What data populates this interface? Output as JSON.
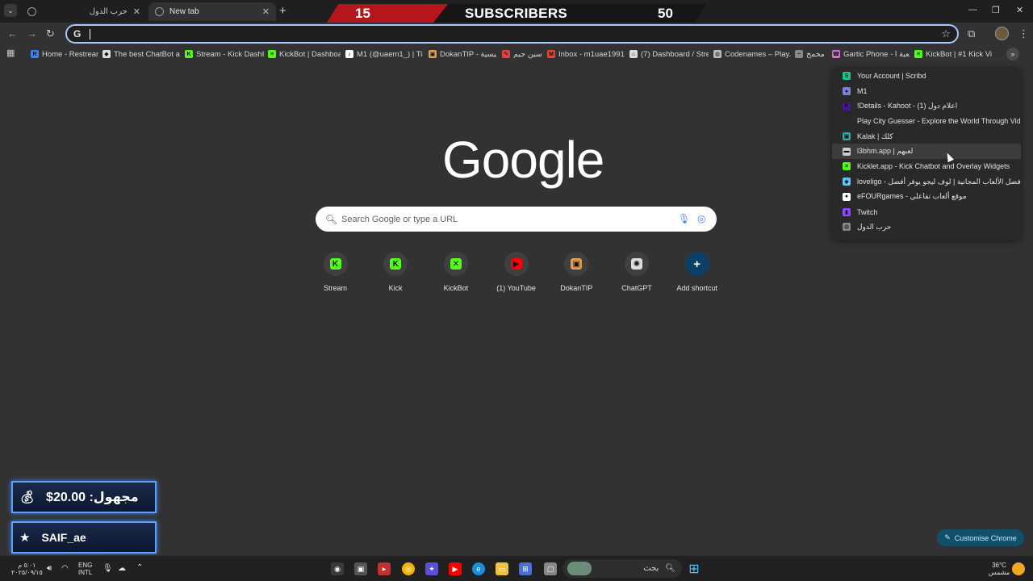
{
  "tabs": [
    {
      "title": "حرب الدول",
      "active": false
    },
    {
      "title": "New tab",
      "active": true
    }
  ],
  "stream_banner": {
    "count": "15",
    "label": "SUBSCRIBERS",
    "goal": "50"
  },
  "omnibox": {
    "value": "",
    "placeholder": ""
  },
  "bookmarks": [
    {
      "label": "Home - Restream",
      "color": "#3b82f6",
      "glyph": "R"
    },
    {
      "label": "The best ChatBot an...",
      "color": "#dddddd",
      "glyph": "◆"
    },
    {
      "label": "Stream - Kick Dashb...",
      "color": "#53fc18",
      "glyph": "K"
    },
    {
      "label": "KickBot | Dashboard",
      "color": "#53fc18",
      "glyph": "✕"
    },
    {
      "label": "M1 (@uaem1_) | Tik...",
      "color": "#ffffff",
      "glyph": "♪"
    },
    {
      "label": "DokanTIP - الرئيسية",
      "color": "#e0a050",
      "glyph": "▣"
    },
    {
      "label": "سين جيم",
      "color": "#e04040",
      "glyph": "✎"
    },
    {
      "label": "Inbox - m1uae1991...",
      "color": "#ea4335",
      "glyph": "M"
    },
    {
      "label": "(7) Dashboard / Stre...",
      "color": "#dddddd",
      "glyph": "⌂"
    },
    {
      "label": "Codenames – Play...",
      "color": "#bbbbbb",
      "glyph": "◍"
    },
    {
      "label": "مخمخ",
      "color": "#888888",
      "glyph": "~"
    },
    {
      "label": "Gartic Phone - لعبة ا...",
      "color": "#d070d0",
      "glyph": "☎"
    },
    {
      "label": "KickBot | #1 Kick Vie...",
      "color": "#53fc18",
      "glyph": "✕"
    }
  ],
  "bookmark_menu": [
    {
      "label": "Your Account | Scribd",
      "color": "#1ec28b",
      "glyph": "S"
    },
    {
      "label": "M1",
      "color": "#7f7fd5",
      "glyph": "●"
    },
    {
      "label": "!Details - Kahoot - (1) اعلام دول",
      "color": "#46178f",
      "glyph": "K"
    },
    {
      "label": "Play City Guesser - Explore the World Through Video",
      "color": "transparent",
      "glyph": ""
    },
    {
      "label": "Kalak | كلك",
      "color": "#3aa0a0",
      "glyph": "▣"
    },
    {
      "label": "l3bhm.app | لعبهم",
      "color": "#cccccc",
      "glyph": "▬"
    },
    {
      "label": "Kicklet.app - Kick Chatbot and Overlay Widgets",
      "color": "#53fc18",
      "glyph": "✕"
    },
    {
      "label": "loveligo - أفضل الألعاب المجانية | لوف ليجو يوفر أفضل...",
      "color": "#5ac8fa",
      "glyph": "◆"
    },
    {
      "label": "eFOURgames - موقع ألعاب تفاعلي",
      "color": "#ffffff",
      "glyph": "●"
    },
    {
      "label": "Twitch",
      "color": "#9146ff",
      "glyph": "▮"
    },
    {
      "label": "حرب الدول",
      "color": "#888888",
      "glyph": "◍"
    }
  ],
  "google": {
    "logo": "Google",
    "search_placeholder": "Search Google or type a URL",
    "shortcuts": [
      {
        "label": "Stream",
        "color": "#53fc18",
        "glyph": "K"
      },
      {
        "label": "Kick",
        "color": "#53fc18",
        "glyph": "K"
      },
      {
        "label": "KickBot",
        "color": "#53fc18",
        "glyph": "✕"
      },
      {
        "label": "(1) YouTube",
        "color": "#ff0000",
        "glyph": "▶"
      },
      {
        "label": "DokanTIP",
        "color": "#e0a050",
        "glyph": "▣"
      },
      {
        "label": "ChatGPT",
        "color": "#dddddd",
        "glyph": "✺"
      },
      {
        "label": "Add shortcut",
        "color": "#0b57d0",
        "glyph": "+"
      }
    ],
    "customise_label": "Customise Chrome"
  },
  "overlay": {
    "donation": "مجهول: 20.00$",
    "follower": "SAIF_ae"
  },
  "taskbar": {
    "time": "٥:٠١ م",
    "date": "٢٠٢٥/٠٩/١٥",
    "lang1": "ENG",
    "lang2": "INTL",
    "search_label": "بحث",
    "temperature": "36°C",
    "weather": "مشمس"
  }
}
